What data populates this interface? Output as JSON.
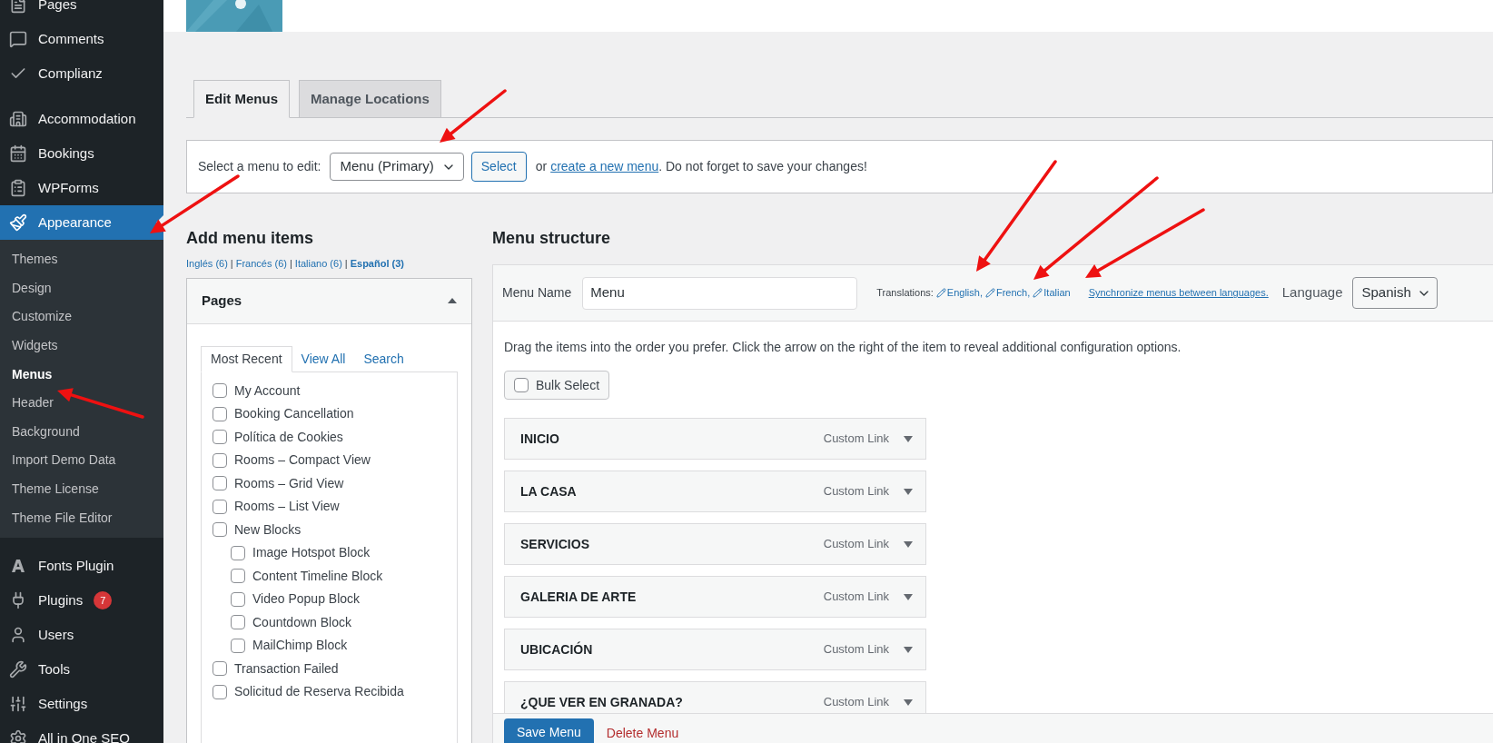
{
  "sidebar": {
    "items": [
      {
        "label": "Pages",
        "selected": false
      },
      {
        "label": "Comments",
        "selected": false
      },
      {
        "label": "Complianz",
        "selected": false
      },
      {
        "label": "Accommodation",
        "selected": false
      },
      {
        "label": "Bookings",
        "selected": false
      },
      {
        "label": "WPForms",
        "selected": false
      },
      {
        "label": "Appearance",
        "selected": true,
        "children": [
          {
            "label": "Themes",
            "selected": false
          },
          {
            "label": "Design",
            "selected": false
          },
          {
            "label": "Customize",
            "selected": false
          },
          {
            "label": "Widgets",
            "selected": false
          },
          {
            "label": "Menus",
            "selected": true
          },
          {
            "label": "Header",
            "selected": false
          },
          {
            "label": "Background",
            "selected": false
          },
          {
            "label": "Import Demo Data",
            "selected": false
          },
          {
            "label": "Theme License",
            "selected": false
          },
          {
            "label": "Theme File Editor",
            "selected": false
          }
        ]
      },
      {
        "label": "Fonts Plugin",
        "selected": false
      },
      {
        "label": "Plugins",
        "selected": false,
        "badge": "7"
      },
      {
        "label": "Users",
        "selected": false
      },
      {
        "label": "Tools",
        "selected": false
      },
      {
        "label": "Settings",
        "selected": false
      },
      {
        "label": "All in One SEO",
        "selected": false
      }
    ]
  },
  "tabs": [
    {
      "label": "Edit Menus",
      "selected": true
    },
    {
      "label": "Manage Locations",
      "selected": false
    }
  ],
  "menu_select": {
    "label": "Select a menu to edit:",
    "value": "Menu (Primary)",
    "button": "Select",
    "text_before": "or",
    "link": "create a new menu",
    "text_after": ". Do not forget to save your changes!"
  },
  "add_menu_items": {
    "title": "Add menu items",
    "separator": "|",
    "languages": [
      {
        "label": "Inglés (6)",
        "selected": false
      },
      {
        "label": "Francés (6)",
        "selected": false
      },
      {
        "label": "Italiano (6)",
        "selected": false
      },
      {
        "label": "Español (3)",
        "selected": true
      }
    ],
    "panel": {
      "title": "Pages",
      "expanded": true,
      "tabs": [
        {
          "label": "Most Recent",
          "selected": true
        },
        {
          "label": "View All",
          "selected": false
        },
        {
          "label": "Search",
          "selected": false
        }
      ],
      "items": [
        {
          "label": "My Account",
          "checked": false
        },
        {
          "label": "Booking Cancellation",
          "checked": false
        },
        {
          "label": "Política de Cookies",
          "checked": false
        },
        {
          "label": "Rooms – Compact View",
          "checked": false
        },
        {
          "label": "Rooms – Grid View",
          "checked": false
        },
        {
          "label": "Rooms – List View",
          "checked": false
        },
        {
          "label": "New Blocks",
          "checked": false,
          "children": [
            {
              "label": "Image Hotspot Block",
              "checked": false
            },
            {
              "label": "Content Timeline Block",
              "checked": false
            },
            {
              "label": "Video Popup Block",
              "checked": false
            },
            {
              "label": "Countdown Block",
              "checked": false
            },
            {
              "label": "MailChimp Block",
              "checked": false
            }
          ]
        },
        {
          "label": "Transaction Failed",
          "checked": false
        },
        {
          "label": "Solicitud de Reserva Recibida",
          "checked": false
        }
      ]
    }
  },
  "menu_structure": {
    "title": "Menu structure",
    "name_label": "Menu Name",
    "name_value": "Menu",
    "translations_label": "Translations:",
    "translations": [
      "English,",
      "French,",
      "Italian"
    ],
    "sync_link": "Synchronize menus between languages.",
    "language_label": "Language",
    "language_value": "Spanish",
    "description": "Drag the items into the order you prefer. Click the arrow on the right of the item to reveal additional configuration options.",
    "bulk_select": {
      "label": "Bulk Select",
      "checked": false
    },
    "items": [
      {
        "label": "INICIO",
        "type": "Custom Link"
      },
      {
        "label": "LA CASA",
        "type": "Custom Link"
      },
      {
        "label": "SERVICIOS",
        "type": "Custom Link"
      },
      {
        "label": "GALERIA DE ARTE",
        "type": "Custom Link"
      },
      {
        "label": "UBICACIÓN",
        "type": "Custom Link"
      },
      {
        "label": "¿QUE VER EN GRANADA?",
        "type": "Custom Link"
      }
    ],
    "save_button": "Save Menu",
    "delete_link": "Delete Menu"
  }
}
